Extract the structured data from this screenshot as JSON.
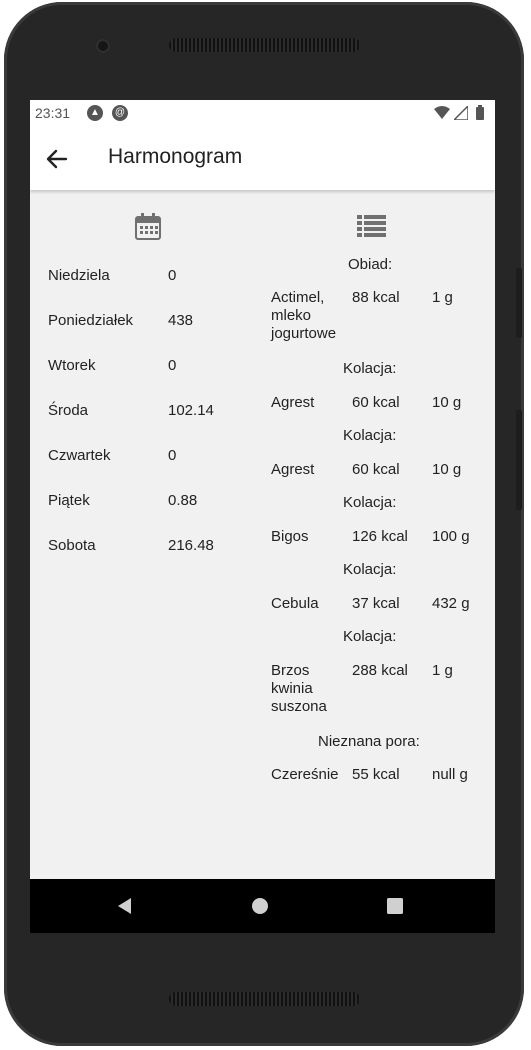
{
  "status": {
    "time": "23:31"
  },
  "appbar": {
    "title": "Harmonogram"
  },
  "icons": {
    "left_column": "calendar-icon",
    "right_column": "list-icon"
  },
  "days": [
    {
      "label": "Niedziela",
      "value": "0"
    },
    {
      "label": "Poniedziałek",
      "value": "438"
    },
    {
      "label": "Wtorek",
      "value": "0"
    },
    {
      "label": "Środa",
      "value": "102.14"
    },
    {
      "label": "Czwartek",
      "value": "0"
    },
    {
      "label": "Piątek",
      "value": "0.88"
    },
    {
      "label": "Sobota",
      "value": "216.48"
    }
  ],
  "meals": [
    {
      "meal": "Obiad:",
      "name": "Actimel, mleko jogurtowe",
      "kcal": "88 kcal",
      "amount": "1 g"
    },
    {
      "meal": "Kolacja:",
      "name": "Agrest",
      "kcal": "60 kcal",
      "amount": "10 g"
    },
    {
      "meal": "Kolacja:",
      "name": "Agrest",
      "kcal": "60 kcal",
      "amount": "10 g"
    },
    {
      "meal": "Kolacja:",
      "name": "Bigos",
      "kcal": "126 kcal",
      "amount": "100 g"
    },
    {
      "meal": "Kolacja:",
      "name": "Cebula",
      "kcal": "37 kcal",
      "amount": "432 g"
    },
    {
      "meal": "Kolacja:",
      "name": "Brzos kwinia suszona",
      "kcal": "288 kcal",
      "amount": "1 g"
    },
    {
      "meal": "Nieznana pora:",
      "name": "Czereśnie",
      "kcal": "55 kcal",
      "amount": "null g"
    }
  ],
  "colors": {
    "screen_bg": "#f1f1f1",
    "appbar_bg": "#ffffff",
    "icon_gray": "#707070",
    "navbar_bg": "#000000"
  }
}
